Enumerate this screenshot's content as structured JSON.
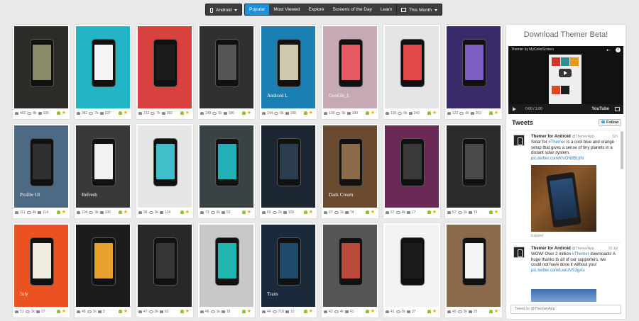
{
  "nav": {
    "platform_label": "Android",
    "tabs": [
      {
        "label": "Popular",
        "active": true
      },
      {
        "label": "Most Viewed",
        "active": false
      },
      {
        "label": "Explore",
        "active": false
      },
      {
        "label": "Screens of the Day",
        "active": false
      },
      {
        "label": "Learn",
        "active": false
      }
    ],
    "rss_icon": "rss-icon",
    "period_label": "This Month"
  },
  "themes": [
    {
      "likes": "402",
      "views": "8k",
      "comments": "335",
      "bg": "#2c2b28",
      "screen": "#8a8a6a",
      "title": ""
    },
    {
      "likes": "281",
      "views": "7k",
      "comments": "337",
      "bg": "#24b4c8",
      "screen": "#f4f4f4",
      "title": ""
    },
    {
      "likes": "212",
      "views": "7k",
      "comments": "282",
      "bg": "#d9413f",
      "screen": "#1c1c1c",
      "title": ""
    },
    {
      "likes": "148",
      "views": "6k",
      "comments": "186",
      "bg": "#303030",
      "screen": "#555555",
      "title": ""
    },
    {
      "likes": "144",
      "views": "6k",
      "comments": "168",
      "bg": "#1a7fb2",
      "screen": "#cfc9b0",
      "title": "Android L"
    },
    {
      "likes": "138",
      "views": "6k",
      "comments": "180",
      "bg": "#c7a9b6",
      "screen": "#e65a63",
      "title": "GooGle_L"
    },
    {
      "likes": "136",
      "views": "6k",
      "comments": "243",
      "bg": "#e4e4e4",
      "screen": "#e14a4a",
      "title": ""
    },
    {
      "likes": "122",
      "views": "6k",
      "comments": "203",
      "bg": "#3b2a6a",
      "screen": "#7a5ec2",
      "title": ""
    },
    {
      "likes": "111",
      "views": "4k",
      "comments": "114",
      "bg": "#4c6a84",
      "screen": "#2f2f2f",
      "title": "Profile UI"
    },
    {
      "likes": "104",
      "views": "3k",
      "comments": "100",
      "bg": "#393939",
      "screen": "#f2f2f2",
      "title": "Refresh"
    },
    {
      "likes": "96",
      "views": "3k",
      "comments": "124",
      "bg": "#e6e6e6",
      "screen": "#3fbfc9",
      "title": ""
    },
    {
      "likes": "73",
      "views": "6k",
      "comments": "53",
      "bg": "#3a4245",
      "screen": "#20b0b5",
      "title": ""
    },
    {
      "likes": "69",
      "views": "2k",
      "comments": "109",
      "bg": "#1c2733",
      "screen": "#2b3d4f",
      "title": ""
    },
    {
      "likes": "67",
      "views": "1k",
      "comments": "74",
      "bg": "#6a4a2e",
      "screen": "#8b6a4a",
      "title": "Dark Cream"
    },
    {
      "likes": "67",
      "views": "4k",
      "comments": "17",
      "bg": "#6a2a55",
      "screen": "#3a3a3a",
      "title": ""
    },
    {
      "likes": "57",
      "views": "1k",
      "comments": "74",
      "bg": "#2b2b2b",
      "screen": "#4a4a4a",
      "title": ""
    },
    {
      "likes": "51",
      "views": "1k",
      "comments": "27",
      "bg": "#ea5222",
      "screen": "#f0ece0",
      "title": "July"
    },
    {
      "likes": "48",
      "views": "1k",
      "comments": "3",
      "bg": "#1c1c1c",
      "screen": "#e8a12c",
      "title": ""
    },
    {
      "likes": "47",
      "views": "2k",
      "comments": "62",
      "bg": "#282828",
      "screen": "#353535",
      "title": ""
    },
    {
      "likes": "46",
      "views": "1k",
      "comments": "18",
      "bg": "#c8c8c8",
      "screen": "#1fb6b0",
      "title": ""
    },
    {
      "likes": "44",
      "views": "718",
      "comments": "10",
      "bg": "#1b2a3a",
      "screen": "#1f4a6a",
      "title": "Trans"
    },
    {
      "likes": "42",
      "views": "4k",
      "comments": "41",
      "bg": "#555555",
      "screen": "#b94a3a",
      "title": ""
    },
    {
      "likes": "41",
      "views": "2k",
      "comments": "37",
      "bg": "#f2f2f2",
      "screen": "#1c1c1c",
      "title": ""
    },
    {
      "likes": "40",
      "views": "3k",
      "comments": "25",
      "bg": "#8a6a4a",
      "screen": "#f4f4f4",
      "title": ""
    }
  ],
  "sidebar": {
    "heading": "Download Themer Beta!",
    "video": {
      "title": "Themer by MyColorScreen",
      "time": "0:00 / 1:00",
      "brand": "YouTube"
    },
    "tweets_heading": "Tweets",
    "follow_label": "Follow",
    "tweets": [
      {
        "author": "Themer for Android",
        "handle": "@ThemerApp",
        "date": "11h",
        "text_pre": "Solar for ",
        "hashtag": "#Themer",
        "text_post": " is a cool blue and orange setup that gives a sense of tiny planets in a distant solar system.",
        "link": "pic.twitter.com/KVON85LjIN",
        "expand": "Expand"
      },
      {
        "author": "Themer for Android",
        "handle": "@ThemerApp",
        "date": "10 Jul",
        "text_pre": "WOW! Over 2 million ",
        "hashtag": "#Themer",
        "text_post": " downloads! A huge thanks to all of our supporters, we could not have done it without you!",
        "link": "pic.twitter.com/LxeUVS3gAu"
      }
    ],
    "tweet_box_placeholder": "Tweet to @ThemerApp"
  }
}
